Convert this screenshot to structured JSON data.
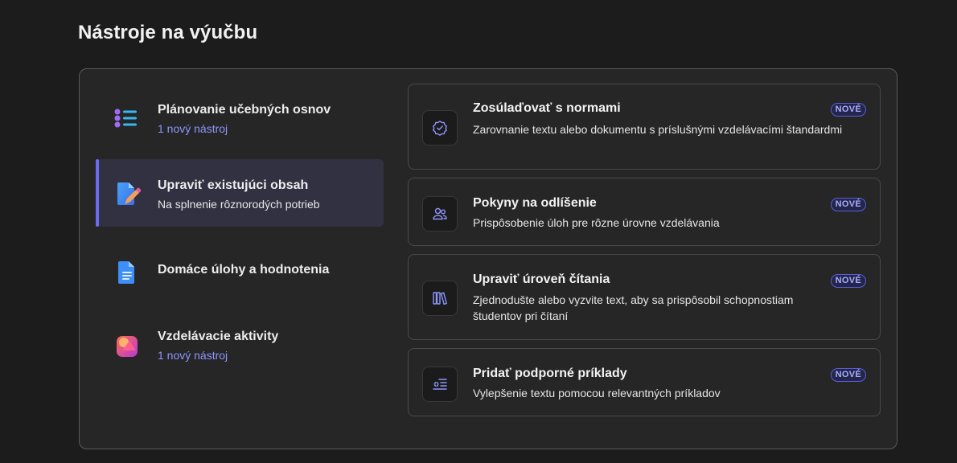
{
  "page_title": "Nástroje na výučbu",
  "categories": [
    {
      "title": "Plánovanie učebných osnov",
      "subtitle": "1 nový nástroj",
      "icon": "list-icon"
    },
    {
      "title": "Upraviť existujúci obsah",
      "subtitle": "Na splnenie rôznorodých potrieb",
      "icon": "edit-document-icon",
      "active": true
    },
    {
      "title": "Domáce úlohy a hodnotenia",
      "subtitle": "",
      "icon": "document-icon"
    },
    {
      "title": "Vzdelávacie aktivity",
      "subtitle": "1 nový nástroj",
      "icon": "activities-icon"
    }
  ],
  "tools": [
    {
      "title": "Zosúlaďovať s normami",
      "description": "Zarovnanie textu alebo dokumentu s príslušnými vzdelávacími štandardmi",
      "badge": "NOVÉ",
      "icon": "badge-check-icon"
    },
    {
      "title": "Pokyny na odlíšenie",
      "description": "Prispôsobenie úloh pre rôzne úrovne vzdelávania",
      "badge": "NOVÉ",
      "icon": "people-icon"
    },
    {
      "title": "Upraviť úroveň čítania",
      "description": "Zjednodušte alebo vyzvite text, aby sa prispôsobil schopnostiam študentov pri čítaní",
      "badge": "NOVÉ",
      "icon": "books-icon"
    },
    {
      "title": "Pridať podporné príklady",
      "description": "Vylepšenie textu pomocou relevantných príkladov",
      "badge": "NOVÉ",
      "icon": "add-list-icon"
    }
  ],
  "colors": {
    "accent": "#6b6cf0",
    "link": "#8e96ff",
    "background": "#1c1c1c",
    "panel": "#262626"
  }
}
